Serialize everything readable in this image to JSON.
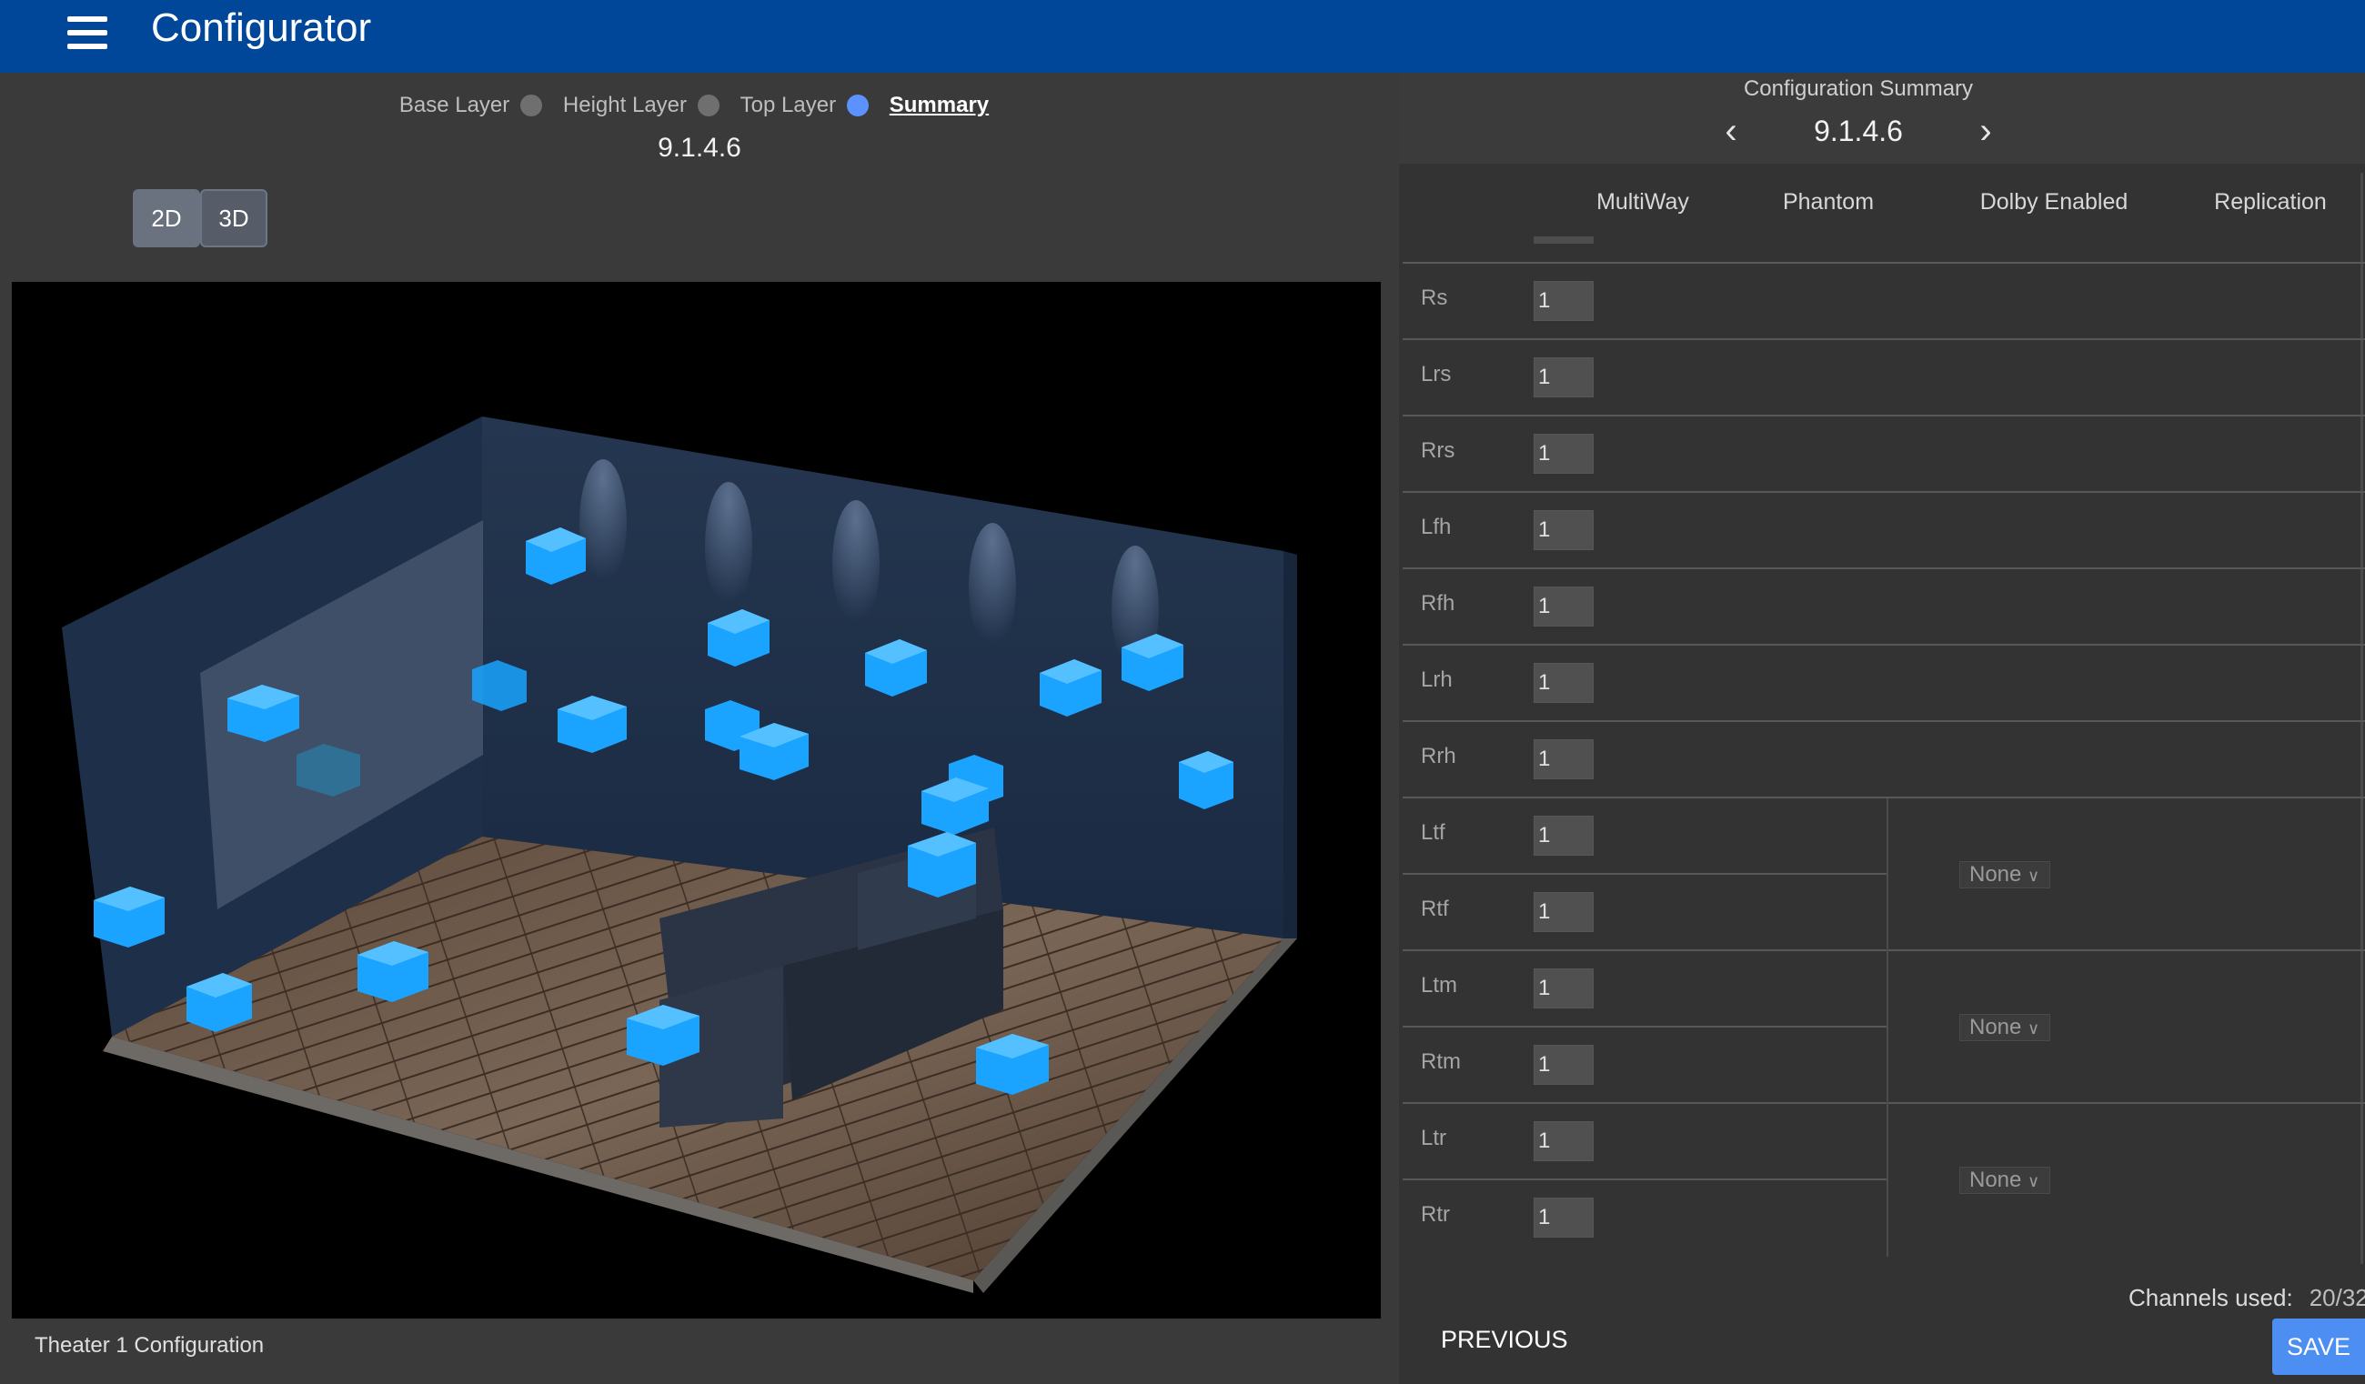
{
  "app": {
    "title": "Configurator"
  },
  "stepper": {
    "steps": [
      {
        "label": "Base Layer",
        "active": false
      },
      {
        "label": "Height Layer",
        "active": false
      },
      {
        "label": "Top Layer",
        "active": false
      },
      {
        "label": "Summary",
        "active": true
      }
    ],
    "current_config": "9.1.4.6"
  },
  "view_toggle": {
    "two_d": "2D",
    "three_d": "3D",
    "selected": "3D"
  },
  "viewport": {
    "caption": "Theater 1 Configuration"
  },
  "summary": {
    "title": "Configuration Summary",
    "config": "9.1.4.6",
    "columns": [
      "MultiWay",
      "Phantom",
      "Dolby Enabled",
      "Replication"
    ],
    "rows": [
      {
        "label": "Rs",
        "value": "1"
      },
      {
        "label": "Lrs",
        "value": "1"
      },
      {
        "label": "Rrs",
        "value": "1"
      },
      {
        "label": "Lfh",
        "value": "1"
      },
      {
        "label": "Rfh",
        "value": "1"
      },
      {
        "label": "Lrh",
        "value": "1"
      },
      {
        "label": "Rrh",
        "value": "1"
      },
      {
        "label": "Ltf",
        "value": "1"
      },
      {
        "label": "Rtf",
        "value": "1"
      },
      {
        "label": "Ltm",
        "value": "1"
      },
      {
        "label": "Rtm",
        "value": "1"
      },
      {
        "label": "Ltr",
        "value": "1"
      },
      {
        "label": "Rtr",
        "value": "1"
      }
    ],
    "pair_selects": [
      "None",
      "None",
      "None"
    ],
    "channels_used_label": "Channels used:",
    "channels_used_value": "20/32"
  },
  "footer": {
    "previous": "PREVIOUS",
    "save": "SAVE"
  },
  "colors": {
    "topbar": "#00479a",
    "accent": "#5b92ff",
    "speaker": "#1aa3ff",
    "save": "#4d8ef2"
  }
}
